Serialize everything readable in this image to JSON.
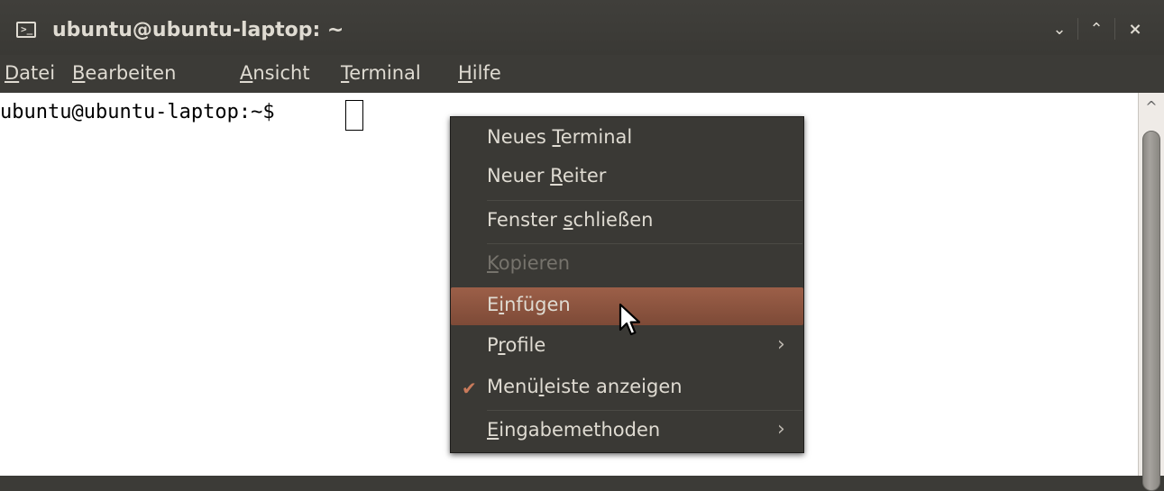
{
  "window": {
    "title": "ubuntu@ubuntu-laptop: ~",
    "terminal_icon_glyph": ">_",
    "controls": {
      "minimize": "⌄",
      "maximize": "⌃",
      "close": "×"
    }
  },
  "menubar": {
    "items": [
      {
        "pre": "",
        "mnemonic": "D",
        "post": "atei"
      },
      {
        "pre": "",
        "mnemonic": "B",
        "post": "earbeiten"
      },
      {
        "pre": "",
        "mnemonic": "A",
        "post": "nsicht"
      },
      {
        "pre": "",
        "mnemonic": "T",
        "post": "erminal"
      },
      {
        "pre": "",
        "mnemonic": "H",
        "post": "ilfe"
      }
    ]
  },
  "terminal": {
    "prompt": "ubuntu@ubuntu-laptop:~$ "
  },
  "context_menu": {
    "items": [
      {
        "pre": "Neues ",
        "mnemonic": "T",
        "post": "erminal",
        "state": "normal"
      },
      {
        "pre": "Neuer ",
        "mnemonic": "R",
        "post": "eiter",
        "state": "normal"
      },
      {
        "pre": "Fenster ",
        "mnemonic": "s",
        "post": "chließen",
        "state": "normal"
      },
      {
        "pre": "",
        "mnemonic": "K",
        "post": "opieren",
        "state": "disabled"
      },
      {
        "pre": "E",
        "mnemonic": "i",
        "post": "nfügen",
        "state": "hover"
      },
      {
        "pre": "P",
        "mnemonic": "r",
        "post": "ofile",
        "state": "normal",
        "submenu": true
      },
      {
        "pre": "Menü",
        "mnemonic": "l",
        "post": "eiste anzeigen",
        "state": "checked"
      },
      {
        "pre": "",
        "mnemonic": "E",
        "post": "ingabemethoden",
        "state": "normal",
        "submenu": true
      }
    ],
    "submenu_arrow": "›",
    "check_mark": "✔"
  },
  "colors": {
    "titlebar_bg": "#3c3b37",
    "menu_text": "#dfdbd2",
    "highlight": "#8a523d",
    "terminal_bg": "#ffffff",
    "disabled_text": "#76736c"
  }
}
